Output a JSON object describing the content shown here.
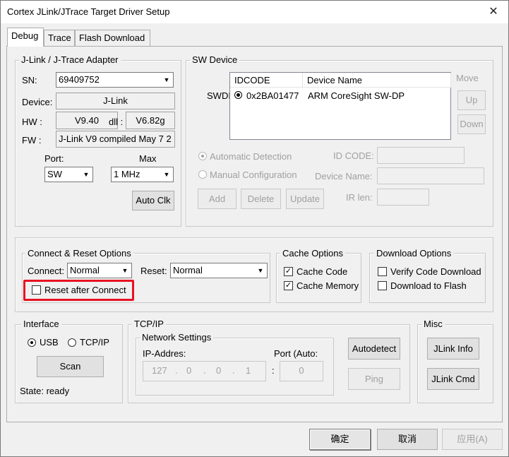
{
  "window": {
    "title": "Cortex JLink/JTrace Target Driver Setup",
    "close_glyph": "✕"
  },
  "tabs": [
    "Debug",
    "Trace",
    "Flash Download"
  ],
  "adapter": {
    "group_label": "J-Link / J-Trace Adapter",
    "sn_label": "SN:",
    "sn_value": "69409752",
    "device_label": "Device:",
    "device_value": "J-Link",
    "hw_label": "HW :",
    "hw_value": "V9.40",
    "dll_label": "dll :",
    "dll_value": "V6.82g",
    "fw_label": "FW :",
    "fw_value": "J-Link V9 compiled May  7 2",
    "port_label": "Port:",
    "port_value": "SW",
    "max_label": "Max",
    "max_value": "1 MHz",
    "auto_clk": "Auto Clk"
  },
  "sw_device": {
    "group_label": "SW Device",
    "swdi_label": "SWDI",
    "columns": [
      "IDCODE",
      "Device Name"
    ],
    "rows": [
      {
        "idcode": "0x2BA01477",
        "device_name": "ARM CoreSight SW-DP"
      }
    ],
    "move_label": "Move",
    "up": "Up",
    "down": "Down",
    "auto_detection": "Automatic Detection",
    "manual_config": "Manual Configuration",
    "id_code_label": "ID CODE:",
    "device_name_label": "Device Name:",
    "ir_len_label": "IR len:",
    "add": "Add",
    "delete": "Delete",
    "update": "Update"
  },
  "connect_reset": {
    "group_label": "Connect & Reset Options",
    "connect_label": "Connect:",
    "connect_value": "Normal",
    "reset_label": "Reset:",
    "reset_value": "Normal",
    "reset_after_connect": "Reset after Connect",
    "reset_after_connect_checked": false
  },
  "cache": {
    "group_label": "Cache Options",
    "cache_code": "Cache Code",
    "cache_code_checked": true,
    "cache_memory": "Cache Memory",
    "cache_memory_checked": true
  },
  "download": {
    "group_label": "Download Options",
    "verify": "Verify Code Download",
    "verify_checked": false,
    "download_flash": "Download to Flash",
    "download_flash_checked": false
  },
  "interface": {
    "group_label": "Interface",
    "usb": "USB",
    "tcpip": "TCP/IP",
    "selected": "USB",
    "scan": "Scan",
    "state": "State: ready"
  },
  "tcpip": {
    "group_label": "TCP/IP",
    "network_settings": "Network Settings",
    "ip_label": "IP-Addres:",
    "ip": [
      "127",
      "0",
      "0",
      "1"
    ],
    "port_label": "Port (Auto:",
    "port_value": "0",
    "colon": ":",
    "autodetect": "Autodetect",
    "ping": "Ping"
  },
  "misc": {
    "group_label": "Misc",
    "jlink_info": "JLink Info",
    "jlink_cmd": "JLink Cmd"
  },
  "footer": {
    "ok": "确定",
    "cancel": "取消",
    "apply": "应用(A)"
  },
  "colors": {
    "highlight": "#e81123",
    "window_bg": "#f0f0f0"
  }
}
